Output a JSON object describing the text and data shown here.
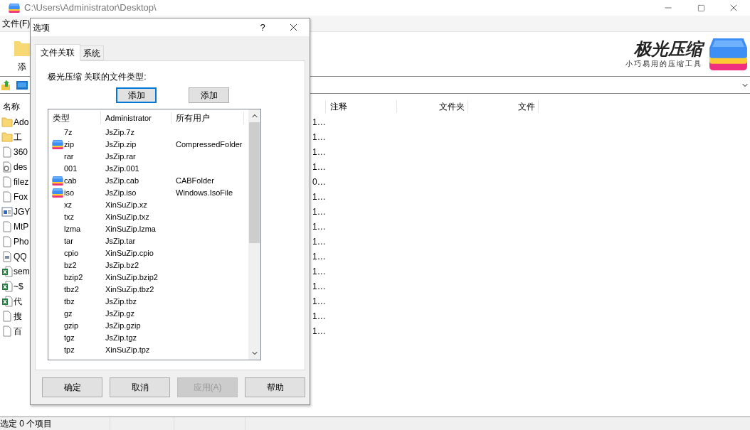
{
  "window": {
    "title": "C:\\Users\\Administrator\\Desktop\\"
  },
  "menu": [
    "文件(F)"
  ],
  "toolbar": {
    "add_label": "添"
  },
  "logo": {
    "name": "极光压缩",
    "slogan": "小巧易用的压缩工具"
  },
  "file_list": {
    "columns": [
      "名称",
      "注释",
      "文件夹",
      "文件"
    ],
    "rows": [
      {
        "kind": "folder",
        "name": "Ado",
        "column_2": "1…"
      },
      {
        "kind": "folder",
        "name": "工",
        "column_2": "1…"
      },
      {
        "kind": "file",
        "name": "360",
        "column_2": "1…"
      },
      {
        "kind": "settings",
        "name": "des",
        "column_2": "1…"
      },
      {
        "kind": "file",
        "name": "filez",
        "column_2": "0…"
      },
      {
        "kind": "file",
        "name": "Fox",
        "column_2": "1…"
      },
      {
        "kind": "app",
        "name": "JGY",
        "column_2": "1…"
      },
      {
        "kind": "file",
        "name": "MtP",
        "column_2": "1…"
      },
      {
        "kind": "file",
        "name": "Pho",
        "column_2": "1…"
      },
      {
        "kind": "doc",
        "name": "QQ",
        "column_2": "1…"
      },
      {
        "kind": "excel",
        "name": "sem",
        "column_2": "1…"
      },
      {
        "kind": "excel",
        "name": "~$",
        "column_2": "1…"
      },
      {
        "kind": "excel",
        "name": "代",
        "column_2": "1…"
      },
      {
        "kind": "file",
        "name": "搜",
        "column_2": "1…"
      },
      {
        "kind": "file",
        "name": "百",
        "column_2": "1…"
      }
    ]
  },
  "status_bar": "选定 0 个项目",
  "dialog": {
    "title": "选项",
    "help": "?",
    "tabs": [
      {
        "label": "文件关联",
        "selected": true
      },
      {
        "label": "系统",
        "selected": false
      }
    ],
    "label": "极光压缩 关联的文件类型:",
    "add_buttons": [
      {
        "label": "添加",
        "focused": true
      },
      {
        "label": "添加",
        "focused": false
      }
    ],
    "list": {
      "columns": [
        "类型",
        "Administrator",
        "所有用户"
      ],
      "rows": [
        {
          "type": "7z",
          "admin": "JsZip.7z",
          "associated": false
        },
        {
          "type": "zip",
          "admin": "JsZip.zip",
          "all_users": "CompressedFolder",
          "associated": true
        },
        {
          "type": "rar",
          "admin": "JsZip.rar",
          "associated": false
        },
        {
          "type": "001",
          "admin": "JsZip.001",
          "associated": false
        },
        {
          "type": "cab",
          "admin": "JsZip.cab",
          "all_users": "CABFolder",
          "associated": true
        },
        {
          "type": "iso",
          "admin": "JsZip.iso",
          "all_users": "Windows.IsoFile",
          "associated": true
        },
        {
          "type": "xz",
          "admin": "XinSuZip.xz",
          "associated": false
        },
        {
          "type": "txz",
          "admin": "XinSuZip.txz",
          "associated": false
        },
        {
          "type": "lzma",
          "admin": "XinSuZip.lzma",
          "associated": false
        },
        {
          "type": "tar",
          "admin": "JsZip.tar",
          "associated": false
        },
        {
          "type": "cpio",
          "admin": "XinSuZip.cpio",
          "associated": false
        },
        {
          "type": "bz2",
          "admin": "JsZip.bz2",
          "associated": false
        },
        {
          "type": "bzip2",
          "admin": "XinSuZip.bzip2",
          "associated": false
        },
        {
          "type": "tbz2",
          "admin": "XinSuZip.tbz2",
          "associated": false
        },
        {
          "type": "tbz",
          "admin": "JsZip.tbz",
          "associated": false
        },
        {
          "type": "gz",
          "admin": "JsZip.gz",
          "associated": false
        },
        {
          "type": "gzip",
          "admin": "JsZip.gzip",
          "associated": false
        },
        {
          "type": "tgz",
          "admin": "JsZip.tgz",
          "associated": false
        },
        {
          "type": "tpz",
          "admin": "XinSuZip.tpz",
          "associated": false
        }
      ]
    },
    "footer_buttons": [
      {
        "label": "确定",
        "disabled": false
      },
      {
        "label": "取消",
        "disabled": false
      },
      {
        "label": "应用(A)",
        "disabled": true
      },
      {
        "label": "帮助",
        "disabled": false
      }
    ]
  }
}
